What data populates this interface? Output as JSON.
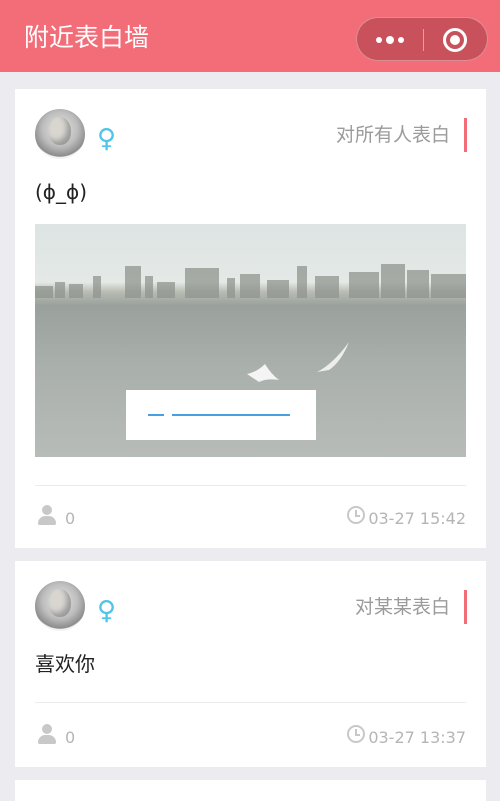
{
  "navbar": {
    "title": "附近表白墙"
  },
  "posts": [
    {
      "gender_symbol": "♀",
      "target": "对所有人表白",
      "text": "(ɸ_ɸ)",
      "likes": "0",
      "time": "03-27 15:42"
    },
    {
      "gender_symbol": "♀",
      "target": "对某某表白",
      "text": "喜欢你",
      "likes": "0",
      "time": "03-27 13:37"
    }
  ],
  "colors": {
    "accent": "#f36d78",
    "gender": "#4fc3e8",
    "muted": "#b5b5b5"
  }
}
